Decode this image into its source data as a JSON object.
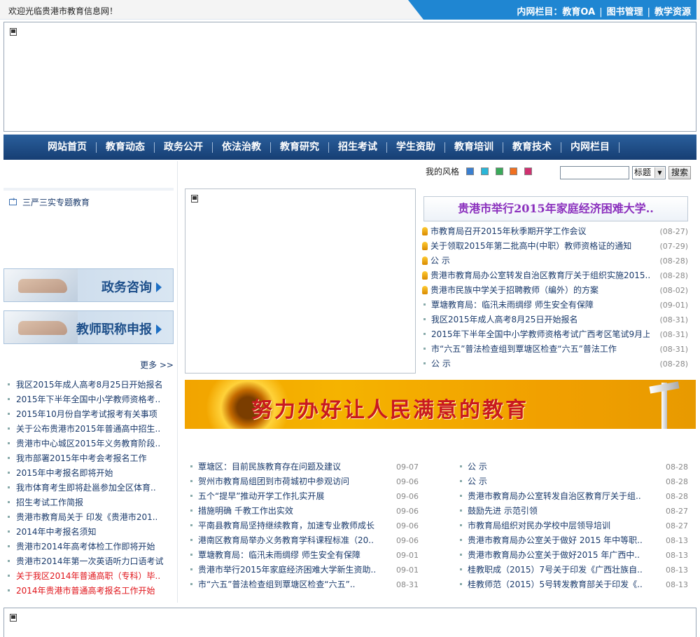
{
  "topbar": {
    "welcome": "欢迎光临贵港市教育信息网！",
    "links": [
      "内网栏目：教育OA",
      "图书管理",
      "教学资源"
    ]
  },
  "nav": [
    "网站首页",
    "教育动态",
    "政务公开",
    "依法治教",
    "教育研究",
    "招生考试",
    "学生资助",
    "教育培训",
    "教育技术",
    "内网栏目"
  ],
  "left": {
    "special_link": "三严三实专题教育",
    "promo1": "政务咨询",
    "promo2": "教师职称申报",
    "more": "更多 >>",
    "items": [
      {
        "title": "我区2015年成人高考8月25日开始报名",
        "red": false
      },
      {
        "title": "2015年下半年全国中小学教师资格考..",
        "red": false
      },
      {
        "title": "2015年10月份自学考试报考有关事项",
        "red": false
      },
      {
        "title": "关于公布贵港市2015年普通高中招生..",
        "red": false
      },
      {
        "title": "贵港市中心城区2015年义务教育阶段..",
        "red": false
      },
      {
        "title": "我市部署2015年中考会考报名工作",
        "red": false
      },
      {
        "title": "2015年中考报名即将开始",
        "red": false
      },
      {
        "title": "我市体育考生即将赴邕参加全区体育..",
        "red": false
      },
      {
        "title": "招生考试工作简报",
        "red": false
      },
      {
        "title": "贵港市教育局关于 印发《贵港市201..",
        "red": false
      },
      {
        "title": "2014年中考报名须知",
        "red": false
      },
      {
        "title": "贵港市2014年高考体检工作即将开始",
        "red": false
      },
      {
        "title": "贵港市2014年第一次英语听力口语考试",
        "red": false
      },
      {
        "title": "关于我区2014年普通高职（专科）毕..",
        "red": true
      },
      {
        "title": "2014年贵港市普通高考报名工作开始",
        "red": true
      }
    ]
  },
  "style_selector": {
    "label": "我的风格",
    "colors": [
      "#3a7fd0",
      "#2ab6d8",
      "#3aaa5a",
      "#f07020",
      "#d03070"
    ]
  },
  "search": {
    "select_value": "标题",
    "button": "搜索"
  },
  "headline": "贵港市举行2015年家庭经济困难大学..",
  "news": [
    {
      "title": "市教育局召开2015年秋季期开学工作会议",
      "date": "(08-27)",
      "icon": "medal"
    },
    {
      "title": "关于领取2015年第二批高中(中职）教师资格证的通知",
      "date": "(07-29)",
      "icon": "medal"
    },
    {
      "title": "公 示",
      "date": "(08-28)",
      "icon": "medal"
    },
    {
      "title": "贵港市教育局办公室转发自治区教育厅关于组织实施2015..",
      "date": "(08-28)",
      "icon": "medal"
    },
    {
      "title": "贵港市民族中学关于招聘教师（编外）的方案",
      "date": "(08-02)",
      "icon": "medal"
    },
    {
      "title": "覃塘教育局：临汛未雨绸缪 师生安全有保障",
      "date": "(09-01)",
      "icon": "square"
    },
    {
      "title": "我区2015年成人高考8月25日开始报名",
      "date": "(08-31)",
      "icon": "square"
    },
    {
      "title": "2015年下半年全国中小学教师资格考试广西考区笔试9月上..",
      "date": "(08-31)",
      "icon": "square"
    },
    {
      "title": "市“六五”普法检查组到覃塘区检查“六五”普法工作",
      "date": "(08-31)",
      "icon": "square"
    },
    {
      "title": "公 示",
      "date": "(08-28)",
      "icon": "square"
    }
  ],
  "slogan": "努力办好让人民满意的教育",
  "list_a": [
    {
      "title": "覃塘区：目前民族教育存在问题及建议",
      "date": "09-07"
    },
    {
      "title": "贺州市教育局组团到市荷城初中参观访问",
      "date": "09-06"
    },
    {
      "title": "五个“提早”推动开学工作扎实开展",
      "date": "09-06"
    },
    {
      "title": "措施明确 千教工作出实效",
      "date": "09-06"
    },
    {
      "title": "平南县教育局坚持继续教育，加速专业教师成长",
      "date": "09-06"
    },
    {
      "title": "港南区教育局举办义务教育学科课程标准（20..",
      "date": "09-06"
    },
    {
      "title": "覃塘教育局：临汛未雨绸缪 师生安全有保障",
      "date": "09-01"
    },
    {
      "title": "贵港市举行2015年家庭经济困难大学新生资助..",
      "date": "09-01"
    },
    {
      "title": "市“六五”普法检查组到覃塘区检查“六五”..",
      "date": "08-31"
    }
  ],
  "list_b": [
    {
      "title": "公 示",
      "date": "08-28"
    },
    {
      "title": "公 示",
      "date": "08-28"
    },
    {
      "title": "贵港市教育局办公室转发自治区教育厅关于组..",
      "date": "08-28"
    },
    {
      "title": "鼓励先进 示范引领",
      "date": "08-27"
    },
    {
      "title": "市教育局组织对民办学校中层领导培训",
      "date": "08-27"
    },
    {
      "title": "贵港市教育局办公室关于做好 2015 年中等职..",
      "date": "08-13"
    },
    {
      "title": "贵港市教育局办公室关于做好2015 年广西中..",
      "date": "08-13"
    },
    {
      "title": "桂教职成（2015）7号关于印发《广西壮族自..",
      "date": "08-13"
    },
    {
      "title": "桂教师范（2015）5号转发教育部关于印发《..",
      "date": "08-13"
    }
  ]
}
